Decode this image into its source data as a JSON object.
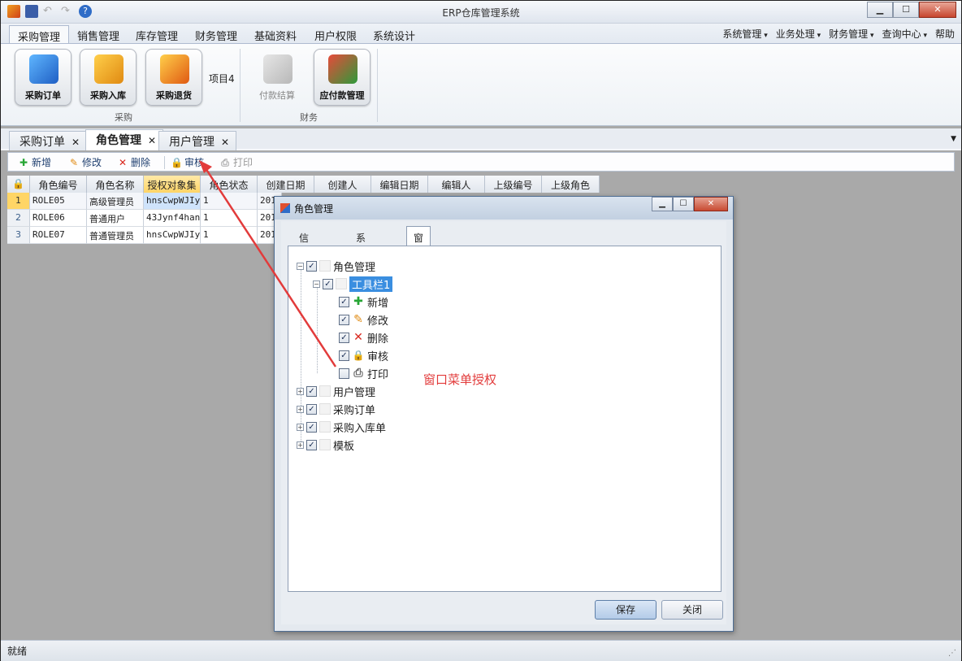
{
  "window": {
    "title": "ERP仓库管理系统",
    "min": "▁",
    "max": "☐",
    "close": "✕"
  },
  "ribbon_tabs": [
    "采购管理",
    "销售管理",
    "库存管理",
    "财务管理",
    "基础资料",
    "用户权限",
    "系统设计"
  ],
  "ribbon_menu": [
    "系统管理",
    "业务处理",
    "财务管理",
    "查询中心",
    "帮助"
  ],
  "ribbon_buttons": {
    "purchase_order": "采购订单",
    "purchase_in": "采购入库",
    "purchase_return": "采购退货",
    "item4": "项目4",
    "payment_settle": "付款结算",
    "payable": "应付款管理"
  },
  "ribbon_groups": {
    "purchase": "采购",
    "finance": "财务"
  },
  "doc_tabs": [
    "采购订单",
    "角色管理",
    "用户管理"
  ],
  "doc_tab_close": "✕",
  "toolbar": {
    "add": "新增",
    "edit": "修改",
    "delete": "删除",
    "audit": "审核",
    "print": "打印"
  },
  "grid": {
    "lock": "🔒",
    "columns": [
      "角色编号",
      "角色名称",
      "授权对象集",
      "角色状态",
      "创建日期",
      "创建人",
      "编辑日期",
      "编辑人",
      "上级编号",
      "上级角色"
    ],
    "rows": [
      {
        "num": "1",
        "id": "ROLE05",
        "name": "高级管理员",
        "auth": "hnsCwpWJIy",
        "status": "1",
        "created": "201"
      },
      {
        "num": "2",
        "id": "ROLE06",
        "name": "普通用户",
        "auth": "43Jynf4han",
        "status": "1",
        "created": "201"
      },
      {
        "num": "3",
        "id": "ROLE07",
        "name": "普通管理员",
        "auth": "hnsCwpWJIy",
        "status": "1",
        "created": "201"
      }
    ]
  },
  "dialog": {
    "title": "角色管理",
    "tabs": [
      "信息修改",
      "系统菜单",
      "窗口菜单"
    ],
    "tree": {
      "root": "角色管理",
      "toolbar": "工具栏1",
      "items": [
        "新增",
        "修改",
        "删除",
        "审核",
        "打印"
      ],
      "others": [
        "用户管理",
        "采购订单",
        "采购入库单",
        "模板"
      ]
    },
    "save": "保存",
    "close": "关闭"
  },
  "annotation": "窗口菜单授权",
  "status": "就绪",
  "colors": {
    "annotation": "#e23b3b",
    "selection": "#3a8ee0"
  }
}
